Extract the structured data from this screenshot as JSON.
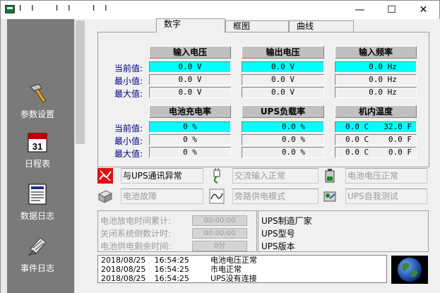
{
  "window": {
    "title": "II  II  II",
    "controls": {
      "minimize": "—",
      "maximize": "☐",
      "close": "✕"
    }
  },
  "sidebar": {
    "items": [
      {
        "label": "参数设置",
        "icon": "hammer-icon"
      },
      {
        "label": "日程表",
        "icon": "calendar-icon"
      },
      {
        "label": "数据日志",
        "icon": "data-log-icon"
      },
      {
        "label": "事件日志",
        "icon": "event-log-icon"
      }
    ],
    "calendar_day": "31"
  },
  "tabs": [
    {
      "label": "数字"
    },
    {
      "label": "框图"
    },
    {
      "label": "曲线"
    }
  ],
  "metrics": {
    "row_labels": [
      "当前值:",
      "最小值:",
      "最大值:"
    ],
    "groups": [
      {
        "title": "输入电压",
        "cur": "0.0 V",
        "min": "0.0 V",
        "max": "0.0 V"
      },
      {
        "title": "输出电压",
        "cur": "0.0 V",
        "min": "0.0 V",
        "max": "0.0 V"
      },
      {
        "title": "输入频率",
        "cur": "0.0 Hz",
        "min": "0.0 Hz",
        "max": "0.0 Hz"
      },
      {
        "title": "电池充电率",
        "cur": "0 %",
        "min": "0 %",
        "max": "0 %"
      },
      {
        "title": "UPS负载率",
        "cur": "0.0 %",
        "min": "0.0 %",
        "max": "0.0 %"
      },
      {
        "title": "机内温度",
        "cur_c": "0.0 C",
        "cur_f": "32.0 F",
        "min_c": "0.0 C",
        "min_f": "0.0 F",
        "max_c": "0.0 C",
        "max_f": "0.0 F"
      }
    ]
  },
  "status": {
    "items": [
      {
        "label": "与UPS通讯异常",
        "icon": "comm-error-icon",
        "active": true
      },
      {
        "label": "交流输入正常",
        "icon": "ac-plug-icon",
        "active": false
      },
      {
        "label": "电池电压正常",
        "icon": "battery-icon",
        "active": false
      },
      {
        "label": "电池故障",
        "icon": "battery-fault-icon",
        "active": false
      },
      {
        "label": "旁路供电模式",
        "icon": "bypass-icon",
        "active": false
      },
      {
        "label": "UPS自我测试",
        "icon": "self-test-icon",
        "active": false
      }
    ]
  },
  "timers": {
    "items": [
      {
        "label": "电池放电时间累计:",
        "value": "00:00:00"
      },
      {
        "label": "关闭系统倒数计时:",
        "value": "00:00:00"
      },
      {
        "label": "电池供电剩余时间:",
        "value": "0分"
      }
    ]
  },
  "ups_info": {
    "manufacturer": "UPS制造厂家",
    "model": "UPS型号",
    "version": "UPS版本"
  },
  "log": {
    "entries": [
      {
        "date": "2018/08/25",
        "time": "16:54:25",
        "message": "电池电压正常"
      },
      {
        "date": "2018/08/25",
        "time": "16:54:25",
        "message": "市电正常"
      },
      {
        "date": "2018/08/25",
        "time": "16:54:25",
        "message": "UPS没有连接"
      }
    ]
  }
}
